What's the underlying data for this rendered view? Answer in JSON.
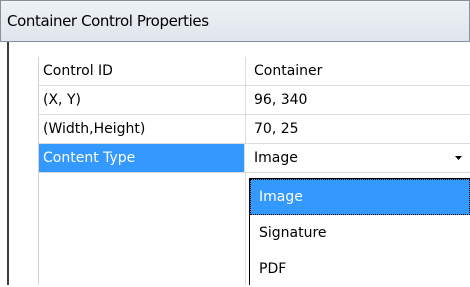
{
  "window": {
    "title": "Container Control Properties"
  },
  "properties": [
    {
      "name": "Control ID",
      "value": "Container"
    },
    {
      "name": "(X, Y)",
      "value": "96, 340"
    },
    {
      "name": "(Width,Height)",
      "value": "70, 25"
    },
    {
      "name": "Content Type",
      "value": "Image",
      "selected": true
    }
  ],
  "content_type_dropdown": {
    "selected_value": "Image",
    "options": [
      "Image",
      "Signature",
      "PDF"
    ],
    "highlighted_option": "Image"
  },
  "colors": {
    "selection": "#3399ff",
    "title_bar": "#dfe5ec",
    "grid_line": "#dcdcdc"
  },
  "icons": {
    "dropdown_arrow": "chevron-down-icon"
  }
}
